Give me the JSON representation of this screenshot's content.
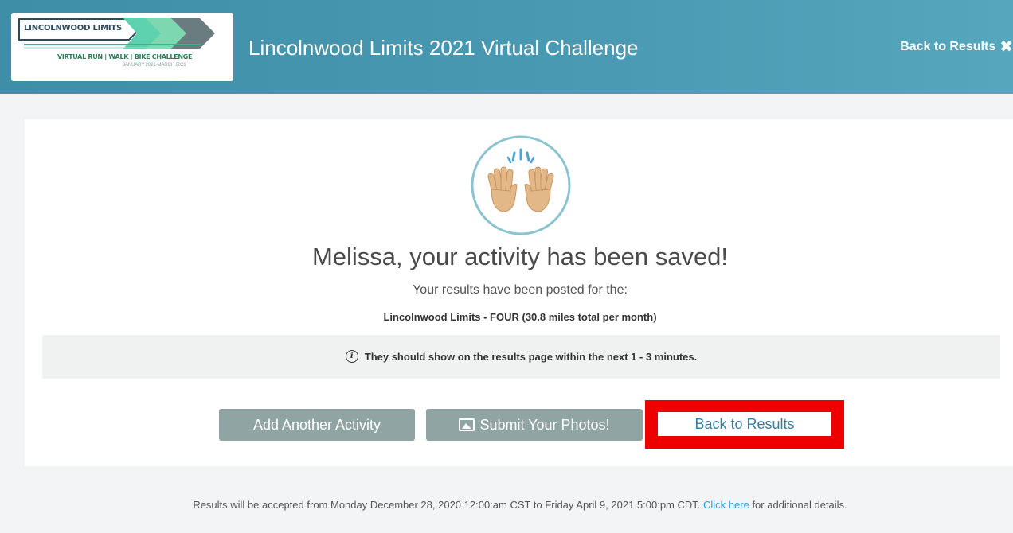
{
  "header": {
    "logo": {
      "line1": "LINCOLNWOOD LIMITS",
      "line2": "VIRTUAL RUN | WALK | BIKE CHALLENGE",
      "line3": "JANUARY 2021-MARCH 2021"
    },
    "title": "Lincolnwood Limits 2021 Virtual Challenge",
    "back_label": "Back to Results",
    "close_icon": "close-icon"
  },
  "main": {
    "icon": "raised-hands-icon",
    "saved_message": "Melissa, your activity has been saved!",
    "posted_line": "Your results have been posted for the:",
    "event_name": "Lincolnwood Limits - FOUR (30.8 miles total per month)",
    "info_text": "They should show on the results page within the next 1 - 3 minutes.",
    "buttons": {
      "add_activity": "Add Another Activity",
      "submit_photos": "Submit Your Photos!",
      "back_to_results": "Back to Results"
    }
  },
  "footer": {
    "text": "Results will be accepted from Monday December 28, 2020 12:00:am CST to Friday April 9, 2021 5:00:pm CDT.",
    "link_text": "Click here",
    "tail_text": "for additional details."
  },
  "colors": {
    "header": "#4a9ab3",
    "button_gray": "#90a4a4",
    "highlight_red": "#ee0000",
    "link_blue": "#2a9fd6"
  }
}
